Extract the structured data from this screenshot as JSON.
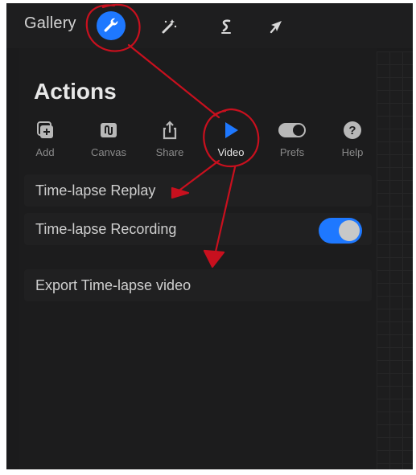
{
  "topbar": {
    "gallery_label": "Gallery",
    "tools": [
      {
        "icon": "wrench-icon",
        "active": true
      },
      {
        "icon": "magic-wand-icon",
        "active": false
      },
      {
        "icon": "selection-icon",
        "active": false
      },
      {
        "icon": "transform-arrow-icon",
        "active": false
      }
    ]
  },
  "panel": {
    "title": "Actions",
    "tabs": [
      {
        "label": "Add",
        "icon": "add-icon"
      },
      {
        "label": "Canvas",
        "icon": "canvas-icon"
      },
      {
        "label": "Share",
        "icon": "share-icon"
      },
      {
        "label": "Video",
        "icon": "play-icon",
        "active": true
      },
      {
        "label": "Prefs",
        "icon": "toggle-icon"
      },
      {
        "label": "Help",
        "icon": "help-icon"
      }
    ],
    "rows": {
      "replay": "Time-lapse Replay",
      "recording": "Time-lapse Recording",
      "recording_enabled": true,
      "export": "Export Time-lapse video"
    }
  },
  "colors": {
    "accent": "#1e78ff",
    "annotation": "#c8101e",
    "background": "#1b1b1c"
  }
}
